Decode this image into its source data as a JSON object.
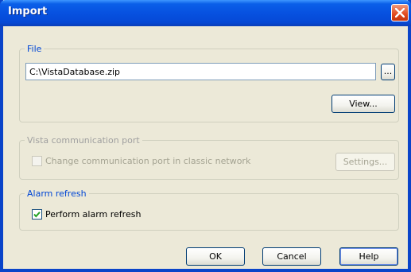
{
  "window": {
    "title": "Import"
  },
  "file_group": {
    "title": "File",
    "path_value": "C:\\VistaDatabase.zip",
    "browse_label": "...",
    "view_label": "View..."
  },
  "port_group": {
    "title": "Vista communication port",
    "checkbox_label": "Change communication port in classic network",
    "checkbox_checked": false,
    "settings_label": "Settings..."
  },
  "alarm_group": {
    "title": "Alarm refresh",
    "checkbox_label": "Perform alarm refresh",
    "checkbox_checked": true
  },
  "buttons": {
    "ok": "OK",
    "cancel": "Cancel",
    "help": "Help"
  },
  "colors": {
    "titlebar": "#0751e0",
    "group_title": "#0046d5",
    "dialog_bg": "#ece9d8"
  },
  "icons": {
    "close": "close-icon",
    "check": "check-icon"
  }
}
